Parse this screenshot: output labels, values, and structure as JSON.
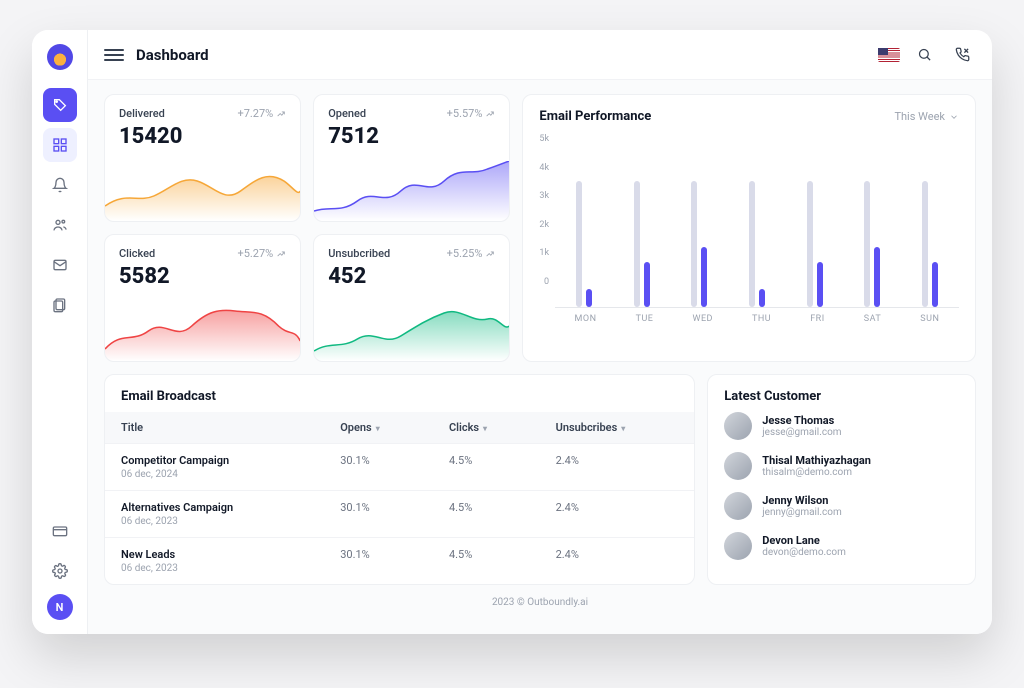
{
  "header": {
    "title": "Dashboard"
  },
  "stats": {
    "delivered": {
      "label": "Delivered",
      "delta": "+7.27%",
      "value": "15420"
    },
    "opened": {
      "label": "Opened",
      "delta": "+5.57%",
      "value": "7512"
    },
    "clicked": {
      "label": "Clicked",
      "delta": "+5.27%",
      "value": "5582"
    },
    "unsub": {
      "label": "Unsubcribed",
      "delta": "+5.25%",
      "value": "452"
    }
  },
  "perf": {
    "title": "Email Performance",
    "range": "This Week",
    "yticks": [
      "5k",
      "4k",
      "3k",
      "2k",
      "1k",
      "0"
    ]
  },
  "chart_data": {
    "type": "bar",
    "categories": [
      "MON",
      "TUE",
      "WED",
      "THU",
      "FRI",
      "SAT",
      "SUN"
    ],
    "series": [
      {
        "name": "background",
        "values": [
          4200,
          4200,
          4200,
          4200,
          4200,
          4200,
          4200
        ]
      },
      {
        "name": "foreground",
        "values": [
          600,
          1500,
          2000,
          600,
          1500,
          2000,
          1500
        ]
      }
    ],
    "ylim": [
      0,
      5000
    ],
    "ylabel": "",
    "xlabel": ""
  },
  "broadcast": {
    "title": "Email Broadcast",
    "cols": {
      "title": "Title",
      "opens": "Opens",
      "clicks": "Clicks",
      "unsubs": "Unsubcribes"
    },
    "rows": [
      {
        "title": "Competitor Campaign",
        "date": "06 dec, 2024",
        "opens": "30.1%",
        "clicks": "4.5%",
        "unsubs": "2.4%"
      },
      {
        "title": "Alternatives Campaign",
        "date": "06 dec, 2023",
        "opens": "30.1%",
        "clicks": "4.5%",
        "unsubs": "2.4%"
      },
      {
        "title": "New Leads",
        "date": "06 dec, 2023",
        "opens": "30.1%",
        "clicks": "4.5%",
        "unsubs": "2.4%"
      }
    ]
  },
  "customers": {
    "title": "Latest Customer",
    "list": [
      {
        "name": "Jesse Thomas",
        "email": "jesse@gmail.com"
      },
      {
        "name": "Thisal Mathiyazhagan",
        "email": "thisalm@demo.com"
      },
      {
        "name": "Jenny Wilson",
        "email": "jenny@gmail.com"
      },
      {
        "name": "Devon Lane",
        "email": "devon@demo.com"
      }
    ]
  },
  "footer": "2023 © Outboundly.ai",
  "avatar_initial": "N"
}
